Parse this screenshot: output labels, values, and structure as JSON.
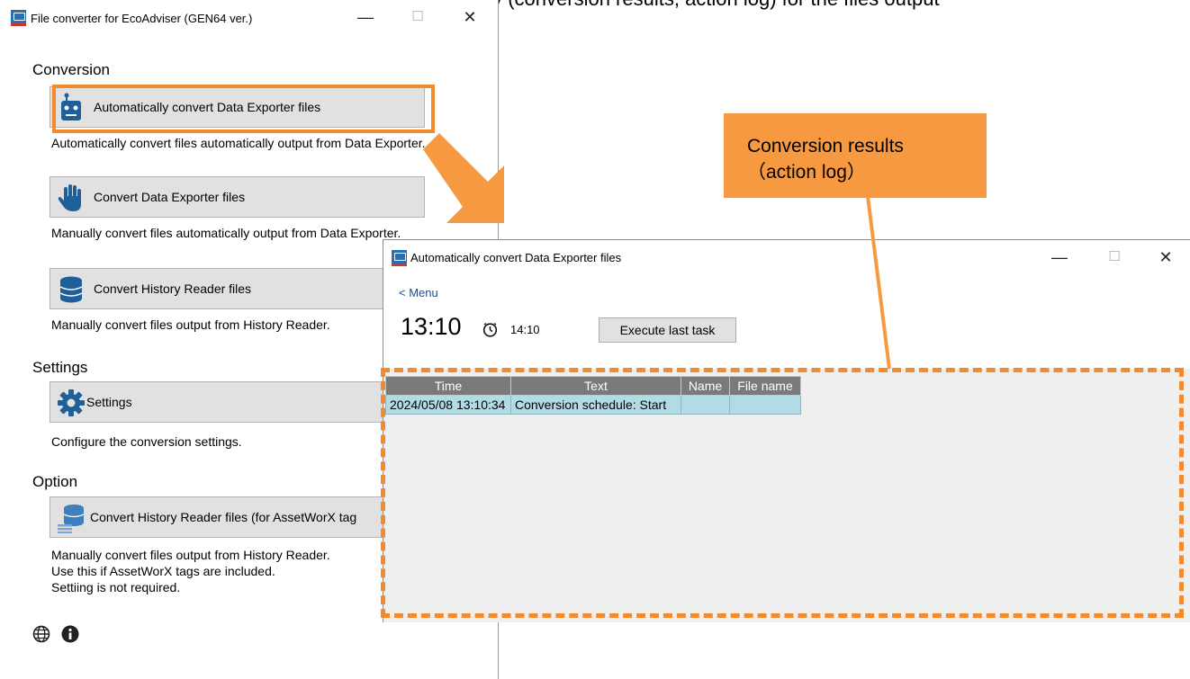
{
  "top_fragment": "played in the activity (conversion results, action log) for the files output",
  "main_window": {
    "title": "File converter for EcoAdviser (GEN64 ver.)",
    "controls": {
      "minimize": "—",
      "maximize": "☐",
      "close": "✕"
    },
    "sections": {
      "conversion": "Conversion",
      "settings": "Settings",
      "option": "Option"
    },
    "buttons": {
      "auto_convert": "Automatically convert Data Exporter files",
      "convert_de": "Convert Data Exporter files",
      "convert_hr": "Convert History Reader files",
      "settings": "Settings",
      "convert_hr_asset": "Convert History Reader files (for AssetWorX tag"
    },
    "descriptions": {
      "auto_convert": "Automatically convert files automatically output from Data Exporter.",
      "convert_de": "Manually convert files automatically output from Data Exporter.",
      "convert_hr": "Manually convert files output from History Reader.",
      "settings": "Configure the conversion settings.",
      "convert_hr_asset_1": "Manually convert files output from History Reader.",
      "convert_hr_asset_2": "Use this if AssetWorX tags are included.",
      "convert_hr_asset_3": "Settiing is not required."
    },
    "icons": [
      "globe-icon",
      "info-icon"
    ]
  },
  "sub_window": {
    "title": "Automatically convert Data Exporter files",
    "controls": {
      "minimize": "—",
      "maximize": "☐",
      "close": "✕"
    },
    "menu_link": "< Menu",
    "current_time": "13:10",
    "scheduled_time": "14:10",
    "execute_button": "Execute last task",
    "log_table": {
      "headers": [
        "Time",
        "Text",
        "Name",
        "File name"
      ],
      "rows": [
        [
          "2024/05/08 13:10:34",
          "Conversion schedule: Start",
          "",
          ""
        ]
      ]
    }
  },
  "annotation": {
    "callout_line1": "Conversion results",
    "callout_line2": "（action log）",
    "accent_color": "#f79940"
  }
}
